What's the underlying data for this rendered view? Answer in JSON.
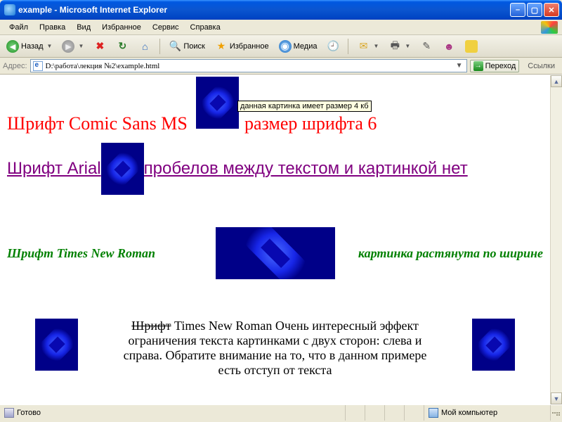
{
  "window": {
    "title": "example - Microsoft Internet Explorer"
  },
  "menu": [
    "Файл",
    "Правка",
    "Вид",
    "Избранное",
    "Сервис",
    "Справка"
  ],
  "toolbar": {
    "back": "Назад",
    "search": "Поиск",
    "favorites": "Избранное",
    "media": "Медиа"
  },
  "address": {
    "label": "Адрес:",
    "value": "D:\\работа\\лекция №2\\example.html",
    "go": "Переход",
    "links": "Ссылки"
  },
  "content": {
    "tooltip": "данная картинка имеет размер 4 кб",
    "line1a": "Шрифт Comic Sans MS",
    "line1b": "размер шрифта 6",
    "line2a": "Шрифт Arial",
    "line2b": "пробелов между текстом и картинкой нет",
    "line3a": "Шрифт Times New Roman",
    "line3b": "картинка растянута по ширине",
    "para4_strike": "Шрифт",
    "para4_rest": " Times New Roman Очень интересный эффект ограничения текста картинками с двух сторон: слева и справа. Обратите внимание на то, что в данном примере есть отступ от текста"
  },
  "status": {
    "ready": "Готово",
    "zone": "Мой компьютер"
  }
}
